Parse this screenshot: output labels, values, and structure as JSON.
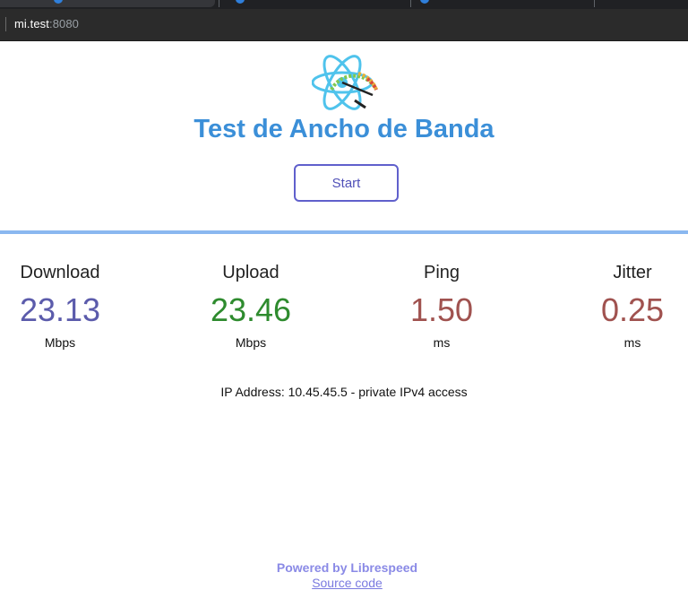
{
  "browser": {
    "url_host": "mi.test",
    "url_port": ":8080"
  },
  "page": {
    "title": "Test de Ancho de Banda",
    "start_label": "Start"
  },
  "metrics": [
    {
      "label": "Download",
      "value": "23.13",
      "unit": "Mbps",
      "color": "#5b5bab"
    },
    {
      "label": "Upload",
      "value": "23.46",
      "unit": "Mbps",
      "color": "#2e8b2e"
    },
    {
      "label": "Ping",
      "value": "1.50",
      "unit": "ms",
      "color": "#a0524f"
    },
    {
      "label": "Jitter",
      "value": "0.25",
      "unit": "ms",
      "color": "#a0524f"
    }
  ],
  "ip_info": "IP Address: 10.45.45.5 - private IPv4 access",
  "footer": {
    "powered": "Powered by Librespeed",
    "source": "Source code"
  },
  "icons": {
    "logo": "atom-speedometer-logo"
  }
}
